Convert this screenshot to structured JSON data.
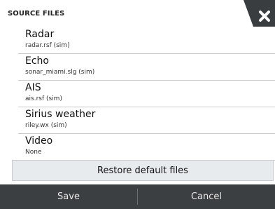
{
  "dialog": {
    "title": "SOURCE FILES",
    "close_icon": "close-icon"
  },
  "sources": [
    {
      "name": "Radar",
      "file": "radar.rsf (sim)"
    },
    {
      "name": "Echo",
      "file": "sonar_miami.slg (sim)"
    },
    {
      "name": "AIS",
      "file": "ais.rsf (sim)"
    },
    {
      "name": "Sirius weather",
      "file": "riley.wx (sim)"
    },
    {
      "name": "Video",
      "file": "None"
    }
  ],
  "restore_label": "Restore default files",
  "footer": {
    "save_label": "Save",
    "cancel_label": "Cancel"
  },
  "colors": {
    "footer_background": "#3c3f42",
    "close_tab": "#3a3d40",
    "restore_background": "#e8ebee"
  }
}
